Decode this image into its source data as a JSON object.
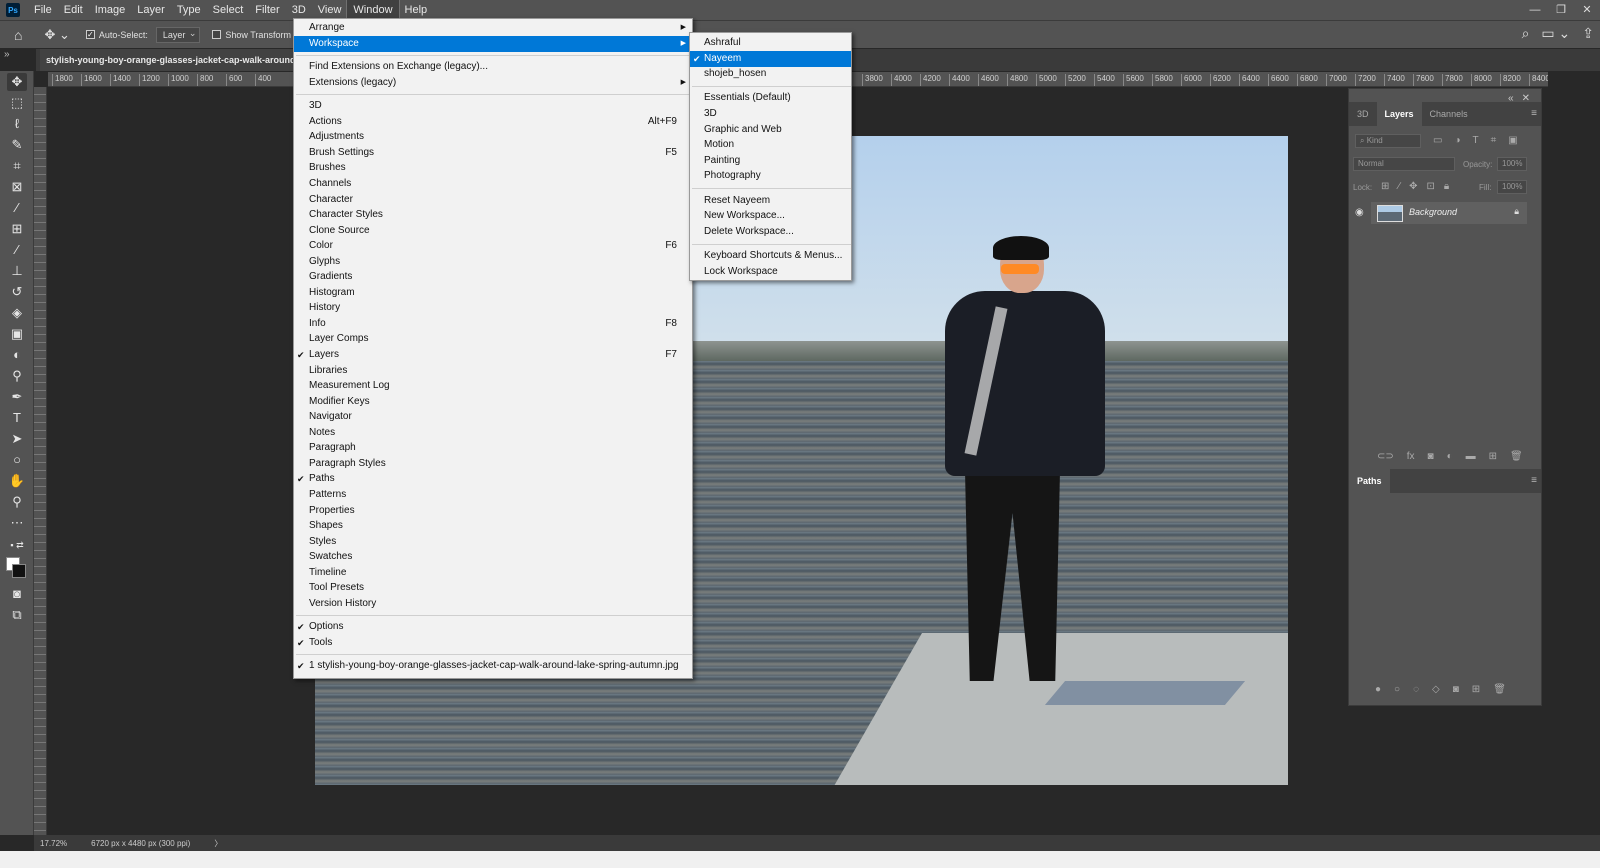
{
  "app": {
    "logo": "Ps"
  },
  "menubar": {
    "items": [
      "File",
      "Edit",
      "Image",
      "Layer",
      "Type",
      "Select",
      "Filter",
      "3D",
      "View",
      "Window",
      "Help"
    ],
    "active": "Window"
  },
  "window_controls": {
    "minimize": "—",
    "restore": "❐",
    "close": "✕"
  },
  "options": {
    "auto_select_label": "Auto-Select:",
    "auto_select_checked": true,
    "auto_select_target": "Layer",
    "show_transform_label": "Show Transform C"
  },
  "document": {
    "tab_title": "stylish-young-boy-orange-glasses-jacket-cap-walk-around-"
  },
  "ruler": {
    "left_ticks": [
      "1800",
      "1600",
      "1400",
      "1200",
      "1000",
      "800",
      "600",
      "400"
    ],
    "right_ticks": [
      "3800",
      "4000",
      "4200",
      "4400",
      "4600",
      "4800",
      "5000",
      "5200",
      "5400",
      "5600",
      "5800",
      "6000",
      "6200",
      "6400",
      "6600",
      "6800",
      "7000",
      "7200",
      "7400",
      "7600",
      "7800",
      "8000",
      "8200",
      "8400"
    ]
  },
  "window_menu": {
    "items": [
      {
        "label": "Arrange",
        "submenu": true
      },
      {
        "label": "Workspace",
        "submenu": true,
        "highlighted": true
      },
      {
        "sep": true
      },
      {
        "label": "Find Extensions on Exchange (legacy)..."
      },
      {
        "label": "Extensions (legacy)",
        "submenu": true
      },
      {
        "sep": true
      },
      {
        "label": "3D"
      },
      {
        "label": "Actions",
        "shortcut": "Alt+F9"
      },
      {
        "label": "Adjustments"
      },
      {
        "label": "Brush Settings",
        "shortcut": "F5"
      },
      {
        "label": "Brushes"
      },
      {
        "label": "Channels"
      },
      {
        "label": "Character"
      },
      {
        "label": "Character Styles"
      },
      {
        "label": "Clone Source"
      },
      {
        "label": "Color",
        "shortcut": "F6"
      },
      {
        "label": "Glyphs"
      },
      {
        "label": "Gradients"
      },
      {
        "label": "Histogram"
      },
      {
        "label": "History"
      },
      {
        "label": "Info",
        "shortcut": "F8"
      },
      {
        "label": "Layer Comps"
      },
      {
        "label": "Layers",
        "shortcut": "F7",
        "checked": true
      },
      {
        "label": "Libraries"
      },
      {
        "label": "Measurement Log"
      },
      {
        "label": "Modifier Keys"
      },
      {
        "label": "Navigator"
      },
      {
        "label": "Notes"
      },
      {
        "label": "Paragraph"
      },
      {
        "label": "Paragraph Styles"
      },
      {
        "label": "Paths",
        "checked": true
      },
      {
        "label": "Patterns"
      },
      {
        "label": "Properties"
      },
      {
        "label": "Shapes"
      },
      {
        "label": "Styles"
      },
      {
        "label": "Swatches"
      },
      {
        "label": "Timeline"
      },
      {
        "label": "Tool Presets"
      },
      {
        "label": "Version History"
      },
      {
        "sep": true
      },
      {
        "label": "Options",
        "checked": true
      },
      {
        "label": "Tools",
        "checked": true
      },
      {
        "sep": true
      },
      {
        "label": "1 stylish-young-boy-orange-glasses-jacket-cap-walk-around-lake-spring-autumn.jpg",
        "checked": true
      }
    ]
  },
  "workspace_menu": {
    "items": [
      {
        "label": "Ashraful"
      },
      {
        "label": "Nayeem",
        "checked": true,
        "highlighted": true
      },
      {
        "label": "shojeb_hosen"
      },
      {
        "sep": true
      },
      {
        "label": "Essentials (Default)"
      },
      {
        "label": "3D"
      },
      {
        "label": "Graphic and Web"
      },
      {
        "label": "Motion"
      },
      {
        "label": "Painting"
      },
      {
        "label": "Photography"
      },
      {
        "sep": true
      },
      {
        "label": "Reset Nayeem"
      },
      {
        "label": "New Workspace..."
      },
      {
        "label": "Delete Workspace..."
      },
      {
        "sep": true
      },
      {
        "label": "Keyboard Shortcuts & Menus..."
      },
      {
        "label": "Lock Workspace"
      }
    ]
  },
  "layers_panel": {
    "tabs": [
      "3D",
      "Layers",
      "Channels"
    ],
    "active_tab": "Layers",
    "kind_placeholder": "Kind",
    "blend_mode": "Normal",
    "opacity_label": "Opacity:",
    "opacity_value": "100%",
    "lock_label": "Lock:",
    "fill_label": "Fill:",
    "fill_value": "100%",
    "layers": [
      {
        "name": "Background",
        "locked": true,
        "visible": true
      }
    ]
  },
  "paths_panel": {
    "tab": "Paths"
  },
  "status": {
    "zoom": "17.72%",
    "doc_info": "6720 px x 4480 px (300 ppi)",
    "arrow": "〉"
  },
  "colors": {
    "highlight": "#0078d7",
    "menubar": "#535353",
    "canvas_bg": "#282828"
  }
}
